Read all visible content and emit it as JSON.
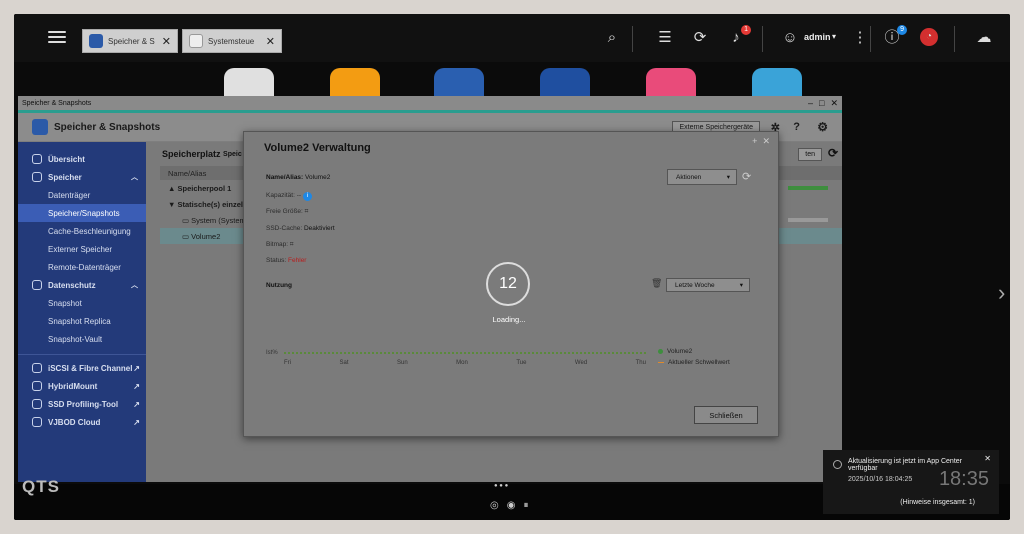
{
  "topbar": {
    "tabs": [
      {
        "label": "Speicher & S"
      },
      {
        "label": "Systemsteue"
      }
    ],
    "user": "admin",
    "notif_badge": "1",
    "info_badge": "9"
  },
  "window": {
    "title": "Speicher & Snapshots",
    "app_title": "Speicher & Snapshots",
    "ext_dropdown": "Externe Speichergeräte"
  },
  "sidebar": {
    "items": [
      {
        "label": "Übersicht",
        "type": "group"
      },
      {
        "label": "Speicher",
        "type": "group"
      },
      {
        "label": "Datenträger"
      },
      {
        "label": "Speicher/Snapshots",
        "selected": true
      },
      {
        "label": "Cache-Beschleunigung"
      },
      {
        "label": "Externer Speicher"
      },
      {
        "label": "Remote-Datenträger"
      },
      {
        "label": "Datenschutz",
        "type": "group"
      },
      {
        "label": "Snapshot"
      },
      {
        "label": "Snapshot Replica"
      },
      {
        "label": "Snapshot-Vault"
      },
      {
        "label": "iSCSI & Fibre Channel",
        "type": "group"
      },
      {
        "label": "HybridMount",
        "type": "group"
      },
      {
        "label": "SSD Profiling-Tool",
        "type": "group"
      },
      {
        "label": "VJBOD Cloud",
        "type": "group"
      }
    ]
  },
  "main": {
    "heading": "Speicherplatz",
    "heading_sub": "Speic",
    "column": "Name/Alias",
    "button_partial": "ten",
    "rows": [
      {
        "label": "Speicherpool 1"
      },
      {
        "label": "Statische(s) einzel"
      },
      {
        "label": "System (System"
      },
      {
        "label": "Volume2"
      }
    ]
  },
  "modal": {
    "title": "Volume2  Verwaltung",
    "name_label": "Name/Alias:",
    "name_value": "Volume2",
    "actions": "Aktionen",
    "capacity_label": "Kapazität:",
    "capacity_value": "--",
    "free_label": "Freie Größe:",
    "ssd_label": "SSD-Cache:",
    "ssd_value": "Deaktiviert",
    "bitmap_label": "Bitmap:",
    "status_label": "Status:",
    "status_value": "Fehler",
    "usage_label": "Nutzung",
    "range": "Letzte Woche",
    "spinner": "12",
    "loading": "Loading...",
    "axis_unit": "Ist%",
    "days": [
      "Fri",
      "Sat",
      "Sun",
      "Mon",
      "Tue",
      "Wed",
      "Thu"
    ],
    "legend_volume": "Volume2",
    "legend_threshold": "Aktueller Schwellwert",
    "close": "Schließen"
  },
  "notification": {
    "title": "Aktualisierung ist jetzt im App Center verfügbar",
    "time": "2025/10/16 18:04:25",
    "count": "(Hinweise insgesamt: 1)",
    "clock": "18:35"
  },
  "footer": {
    "logo": "QTS"
  },
  "colors": {
    "sidebar": "#233a7a",
    "accent": "#2a9d8f",
    "error": "#c62828"
  }
}
